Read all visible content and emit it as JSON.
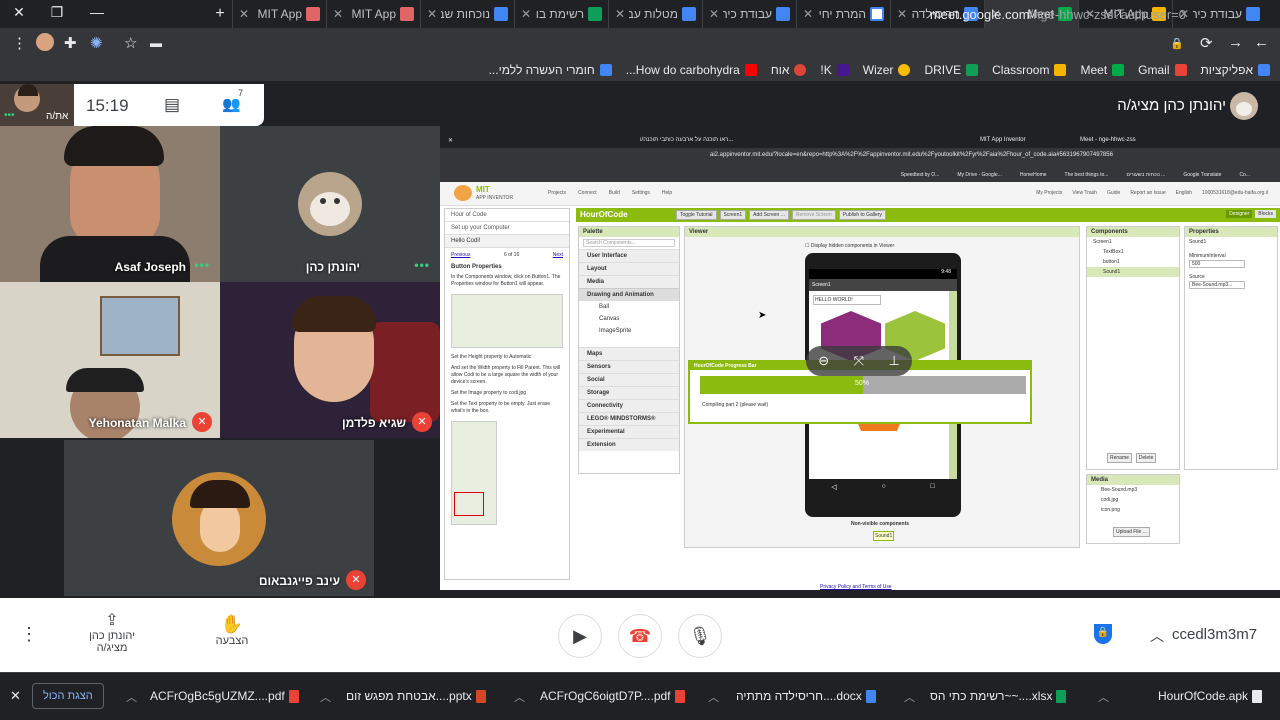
{
  "tabs": [
    {
      "label": "עבודת כיתה"
    },
    {
      "label": "MIT App"
    },
    {
      "label": "Meet",
      "active": true
    },
    {
      "label": "חריסילדה"
    },
    {
      "label": "המרת יחי"
    },
    {
      "label": "עבודת כית"
    },
    {
      "label": "מטלות עב"
    },
    {
      "label": "רשימת בו"
    },
    {
      "label": "נוכחות שב"
    },
    {
      "label": "MIT App"
    },
    {
      "label": "MIT App"
    }
  ],
  "address": {
    "host": "meet.google.com",
    "path": "/nge-hhwc-zss?authuser=0"
  },
  "bookmarks": [
    "אפליקציות",
    "Gmail",
    "Meet",
    "Classroom",
    "DRIVE",
    "Wizer",
    "K!",
    "אוח",
    "How do carbohydra...",
    "חומרי העשרה ללמי..."
  ],
  "meeting": {
    "time": "15:19",
    "self_label": "את/ה",
    "presenter_label": "יהונתן כהן מציג/ה",
    "participants": [
      {
        "name": "Asaf Joseph"
      },
      {
        "name": "יהונתן כהן"
      },
      {
        "name": "Yehonatan Malka"
      },
      {
        "name": "שגיא פלדמן"
      },
      {
        "name": "עינב פייגנבאום"
      }
    ],
    "meeting_code": "ccedl3m3m7",
    "present_label": "יהונתן כהן מציג/ה",
    "raise_hand_label": "הצבעה"
  },
  "shared_screen": {
    "tabs": [
      "MIT App Inventor",
      "Meet - nge-hhwc-zss",
      "ראו תוכנה על ארבעה כותבי תוכנה/ו..."
    ],
    "url": "ai2.appinventor.mit.edu/?locale=en&repo=http%3A%2F%2Fappinventor.mit.edu%2Fyoutoolkit%2Fyr%2Faia%2Fhour_of_code.aia#5631967907497856",
    "bookmarks": [
      "Co...",
      "Google Translate",
      "נוכחות בשעורים ...",
      "The best things to...",
      "HomeHome",
      "My Drive - Google...",
      "Speedtest by O..."
    ],
    "ai_logo_title": "MIT",
    "ai_logo_sub": "APP INVENTOR",
    "ai_menu": [
      "Projects",
      "Connect",
      "Build",
      "Settings",
      "Help"
    ],
    "ai_right_menu": [
      "My Projects",
      "View Trash",
      "Guide",
      "Report an Issue",
      "English",
      "1000531618@edu-haifa.org.il"
    ],
    "project_name": "HourOfCode",
    "toolbar": [
      "Toggle Tutorial",
      "Screen1",
      "Add Screen ...",
      "Remove Screen",
      "Publish to Gallery"
    ],
    "designer_blocks": [
      "Designer",
      "Blocks"
    ],
    "tutorial": {
      "items": [
        "Hour of Code",
        "Set up your Computer",
        "Hello Codi!"
      ],
      "nav_prev": "Previous",
      "nav_pos": "6 of 16",
      "nav_next": "Next",
      "heading": "Button Properties",
      "p1": "In the Components window, click on Button1. The Properties window for Button1 will appear.",
      "p2": "Set the Height property to Automatic",
      "p3": "And set the Width property to Fill Parent. This will allow Codi to be a large square the width of your device's screen.",
      "p4": "Set the Image property to codi.jpg",
      "p5": "Set the Text property to be empty. Just erase what's in the box."
    },
    "palette": {
      "title": "Palette",
      "search_placeholder": "Search Components...",
      "categories_top": [
        "User Interface",
        "Layout",
        "Media",
        "Drawing and Animation"
      ],
      "drawing_items": [
        "Ball",
        "Canvas",
        "ImageSprite"
      ],
      "categories_bottom": [
        "Maps",
        "Sensors",
        "Social",
        "Storage",
        "Connectivity",
        "LEGO® MINDSTORMS®",
        "Experimental",
        "Extension"
      ]
    },
    "viewer": {
      "title": "Viewer",
      "hidden_label": "Display hidden components in Viewer",
      "phone_time": "9:48",
      "screen_title": "Screen1",
      "textbox_value": "HELLO WORLD!",
      "nonvisible_label": "Non-visible components",
      "nonvisible_item": "Sound1"
    },
    "progress": {
      "title": "HourOfCode Progress Bar",
      "percent_label": "50%",
      "value": 0.5,
      "status": "Compiling part 2 (please wait)"
    },
    "components": {
      "title": "Components",
      "items": [
        "Screen1",
        "TextBox1",
        "button1",
        "Sound1"
      ],
      "rename": "Rename",
      "delete": "Delete"
    },
    "media": {
      "title": "Media",
      "items": [
        "Bee-Sound.mp3",
        "codi.jpg",
        "icon.png"
      ],
      "upload": "Upload File ..."
    },
    "properties": {
      "title": "Properties",
      "component": "Sound1",
      "min_label": "MinimumInterval",
      "min_value": "500",
      "source_label": "Source",
      "source_value": "Bee-Sound.mp3..."
    },
    "footer": "Privacy Policy and Terms of Use"
  },
  "downloads": [
    {
      "name": "HourOfCode.apk",
      "type": "apk"
    },
    {
      "name": "רשימת כתי הס~~....xlsx",
      "type": "xlsx"
    },
    {
      "name": "חריסילדה מתתיה....docx",
      "type": "docx"
    },
    {
      "name": "ACFrOgC6oigtD7P....pdf",
      "type": "pdf"
    },
    {
      "name": "אבטחת מפגש זום....pptx",
      "type": "pptx"
    },
    {
      "name": "ACFrOgBc5gUZMZ....pdf",
      "type": "pdf"
    }
  ],
  "show_all_label": "הצגת הכול",
  "colors": {
    "accent_green": "#8bbb0f",
    "meet_red": "#ea4335",
    "meet_blue": "#1a73e8",
    "status_green": "#35d07f"
  }
}
